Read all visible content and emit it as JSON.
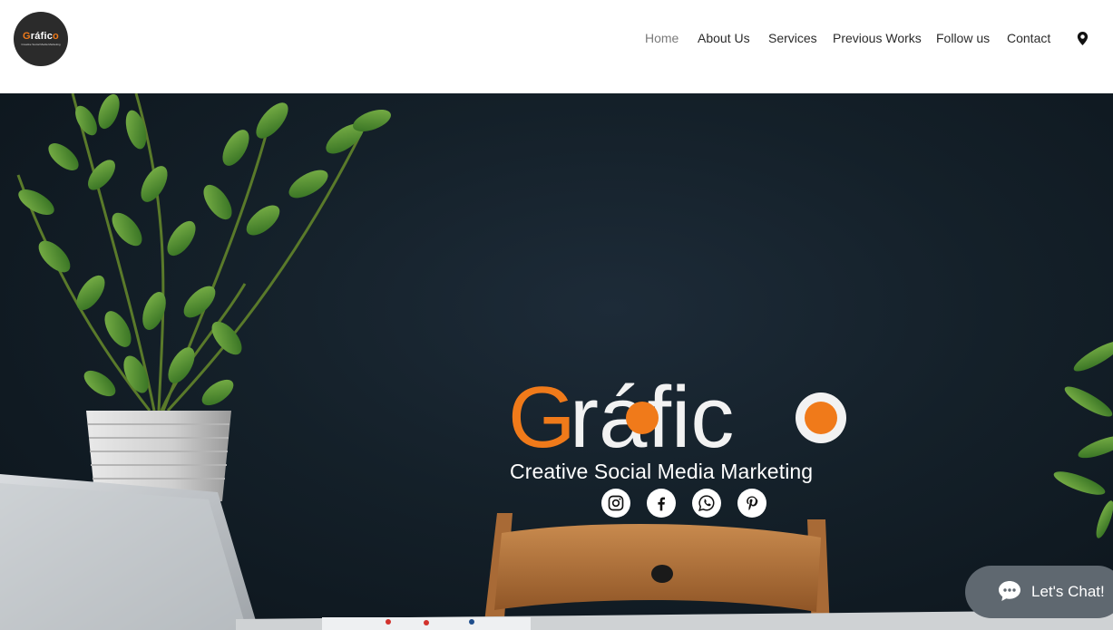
{
  "header": {
    "logo": {
      "wordmark": "Gráfico",
      "tagline": "Creative Social Media Marketing",
      "icon": "grafico-logo"
    },
    "nav": [
      {
        "label": "Home",
        "active": true
      },
      {
        "label": "About Us"
      },
      {
        "label": "Services"
      },
      {
        "label": "Previous Works"
      },
      {
        "label": "Follow us"
      },
      {
        "label": "Contact"
      }
    ],
    "location_icon": "map-pin-icon"
  },
  "hero": {
    "brand": "Gráfico",
    "tagline": "Creative Social Media Marketing",
    "social": [
      {
        "icon": "instagram-icon"
      },
      {
        "icon": "facebook-icon"
      },
      {
        "icon": "whatsapp-icon"
      },
      {
        "icon": "pinterest-icon"
      }
    ]
  },
  "chat": {
    "label": "Let's Chat!",
    "icon": "chat-bubble-icon"
  },
  "colors": {
    "accent": "#f07a1a",
    "hero_bg": "#142029",
    "chat_bg": "#5f6870"
  }
}
